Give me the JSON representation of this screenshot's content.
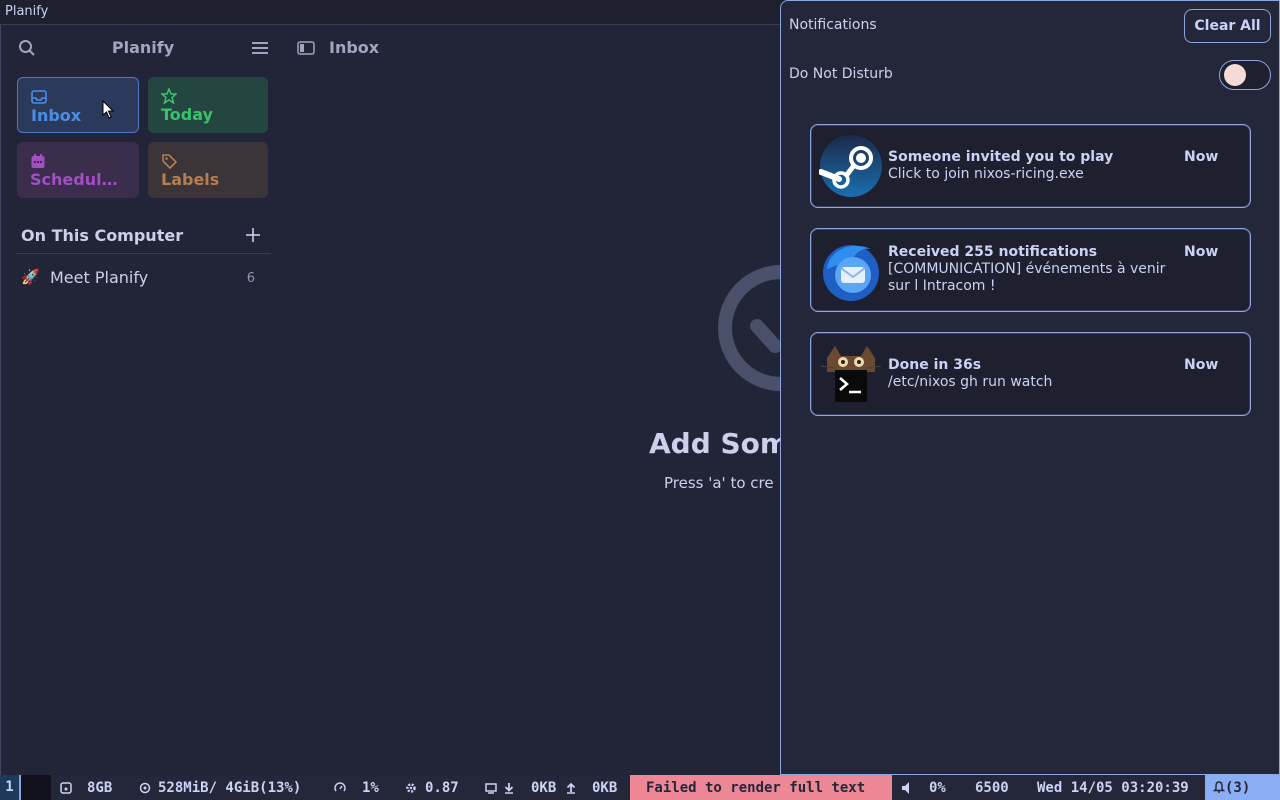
{
  "window": {
    "title": "Planify"
  },
  "sidebar": {
    "app_name": "Planify",
    "filters": [
      {
        "label": "Inbox",
        "color": "#4a8ee8"
      },
      {
        "label": "Today",
        "color": "#3ac26a"
      },
      {
        "label": "Schedul…",
        "color": "#a24fc4"
      },
      {
        "label": "Labels",
        "color": "#b57e50"
      }
    ],
    "section_title": "On This Computer",
    "projects": [
      {
        "icon": "🚀",
        "name": "Meet Planify",
        "count": "6"
      }
    ]
  },
  "main": {
    "title": "Inbox",
    "empty_title": "Add Som",
    "empty_subtitle": "Press 'a' to cre"
  },
  "notification_center": {
    "title": "Notifications",
    "clear_all": "Clear All",
    "dnd_label": "Do Not Disturb",
    "dnd_on": false,
    "notifications": [
      {
        "icon": "steam-icon",
        "summary": "Someone invited you to play",
        "body": "Click to join nixos-ricing.exe",
        "time": "Now"
      },
      {
        "icon": "thunderbird-icon",
        "summary": "Received 255 notifications",
        "body": "[COMMUNICATION] événements à venir sur l Intracom !",
        "time": "Now"
      },
      {
        "icon": "terminal-cat-icon",
        "summary": "Done in 36s",
        "body": "/etc/nixos gh run watch",
        "time": "Now"
      }
    ]
  },
  "statusbar": {
    "workspace": "1",
    "disk": "8GB",
    "memory": "528MiB/ 4GiB(13%)",
    "cpu": "1%",
    "load": "0.87",
    "net_down": "0KB",
    "net_up": "0KB",
    "error": "Failed to render full text",
    "volume": "0%",
    "temperature": "6500",
    "clock": "Wed 14/05 03:20:39",
    "notifications": "(3)"
  }
}
